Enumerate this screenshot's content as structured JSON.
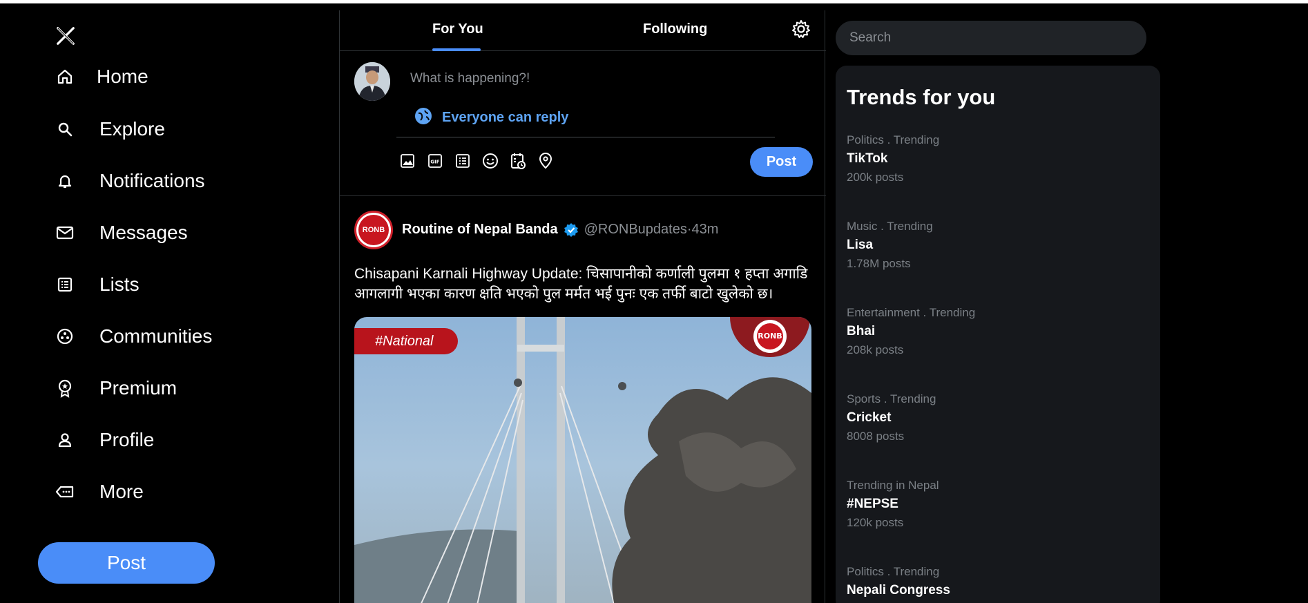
{
  "nav": {
    "logo": "X",
    "items": [
      {
        "label": "Home",
        "icon": "home-icon"
      },
      {
        "label": "Explore",
        "icon": "search-icon"
      },
      {
        "label": "Notifications",
        "icon": "bell-icon"
      },
      {
        "label": "Messages",
        "icon": "mail-icon"
      },
      {
        "label": "Lists",
        "icon": "list-icon"
      },
      {
        "label": "Communities",
        "icon": "communities-icon"
      },
      {
        "label": "Premium",
        "icon": "premium-icon"
      },
      {
        "label": "Profile",
        "icon": "profile-icon"
      },
      {
        "label": "More",
        "icon": "more-icon"
      }
    ],
    "post_label": "Post"
  },
  "tabs": {
    "for_you": "For You",
    "following": "Following"
  },
  "composer": {
    "placeholder": "What is happening?!",
    "reply_setting": "Everyone can reply",
    "post_label": "Post",
    "tools": [
      "image-icon",
      "gif-icon",
      "poll-icon",
      "emoji-icon",
      "schedule-icon",
      "location-icon"
    ]
  },
  "tweet": {
    "avatar_text": "RONB",
    "author": "Routine of Nepal Banda",
    "handle": "@RONBupdates",
    "time": "43m",
    "separator": " · ",
    "text": "Chisapani Karnali Highway Update: चिसापानीको कर्णाली पुलमा १ हप्ता अगाडि आगलागी भएका कारण क्षति भएको पुल मर्मत भई पुनः एक तर्फी बाटो खुलेको छ।",
    "media_tag": "#National",
    "media_logo": "RONB"
  },
  "search": {
    "placeholder": "Search"
  },
  "trends": {
    "title": "Trends for you",
    "items": [
      {
        "category": "Politics . Trending",
        "name": "TikTok",
        "count": "200k posts"
      },
      {
        "category": "Music . Trending",
        "name": "Lisa",
        "count": "1.78M posts"
      },
      {
        "category": "Entertainment . Trending",
        "name": "Bhai",
        "count": "208k posts"
      },
      {
        "category": "Sports . Trending",
        "name": "Cricket",
        "count": "8008 posts"
      },
      {
        "category": "Trending in Nepal",
        "name": "#NEPSE",
        "count": "120k posts"
      },
      {
        "category": "Politics . Trending",
        "name": "Nepali Congress",
        "count": ""
      }
    ]
  },
  "colors": {
    "accent": "#4a8df8",
    "reply_link": "#5ea4f4",
    "brand_red": "#c8161f"
  }
}
